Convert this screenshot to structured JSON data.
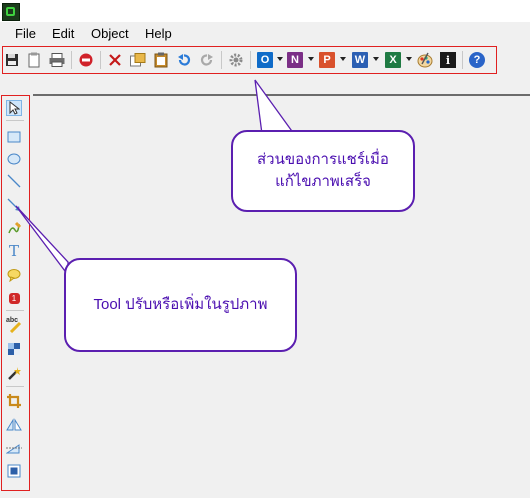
{
  "menu": {
    "file": "File",
    "edit": "Edit",
    "object": "Object",
    "help": "Help"
  },
  "toolbar": {
    "buttons": [
      "save-icon",
      "paste-icon",
      "print-icon",
      "stop-icon",
      "cut-icon",
      "copy-icon",
      "clipboard-icon",
      "undo-icon",
      "redo-icon",
      "settings-icon",
      "outlook-icon",
      "onenote-icon",
      "powerpoint-icon",
      "word-icon",
      "excel-icon",
      "paint-icon",
      "info-icon",
      "help-icon"
    ],
    "office_letters": {
      "outlook": "O",
      "onenote": "N",
      "powerpoint": "P",
      "word": "W",
      "excel": "X"
    },
    "info_letter": "i",
    "help_letter": "?"
  },
  "sidebar": {
    "tools": [
      "select-tool-icon",
      "rectangle-tool-icon",
      "ellipse-tool-icon",
      "line-tool-icon",
      "arrow-tool-icon",
      "pen-tool-icon",
      "text-tool-icon",
      "speech-bubble-tool-icon",
      "step-number-tool-icon",
      "spell-marker-tool-icon",
      "blur-tool-icon",
      "magic-wand-tool-icon",
      "crop-tool-icon",
      "flip-horizontal-tool-icon",
      "flip-vertical-tool-icon",
      "resize-canvas-tool-icon"
    ],
    "text_tool_glyph": "T",
    "step_number_glyph": "1",
    "spell_marker_glyph": "abc"
  },
  "callouts": {
    "toolbar_note_line1": "ส่วนของการแชร์เมื่อ",
    "toolbar_note_line2": "แก้ไขภาพเสร็จ",
    "sidebar_note": "Tool ปรับหรือเพิ่มในรูปภาพ"
  },
  "colors": {
    "highlight_border": "#e02020",
    "callout_border": "#5b1fb0",
    "callout_text": "#4a0eb0"
  }
}
